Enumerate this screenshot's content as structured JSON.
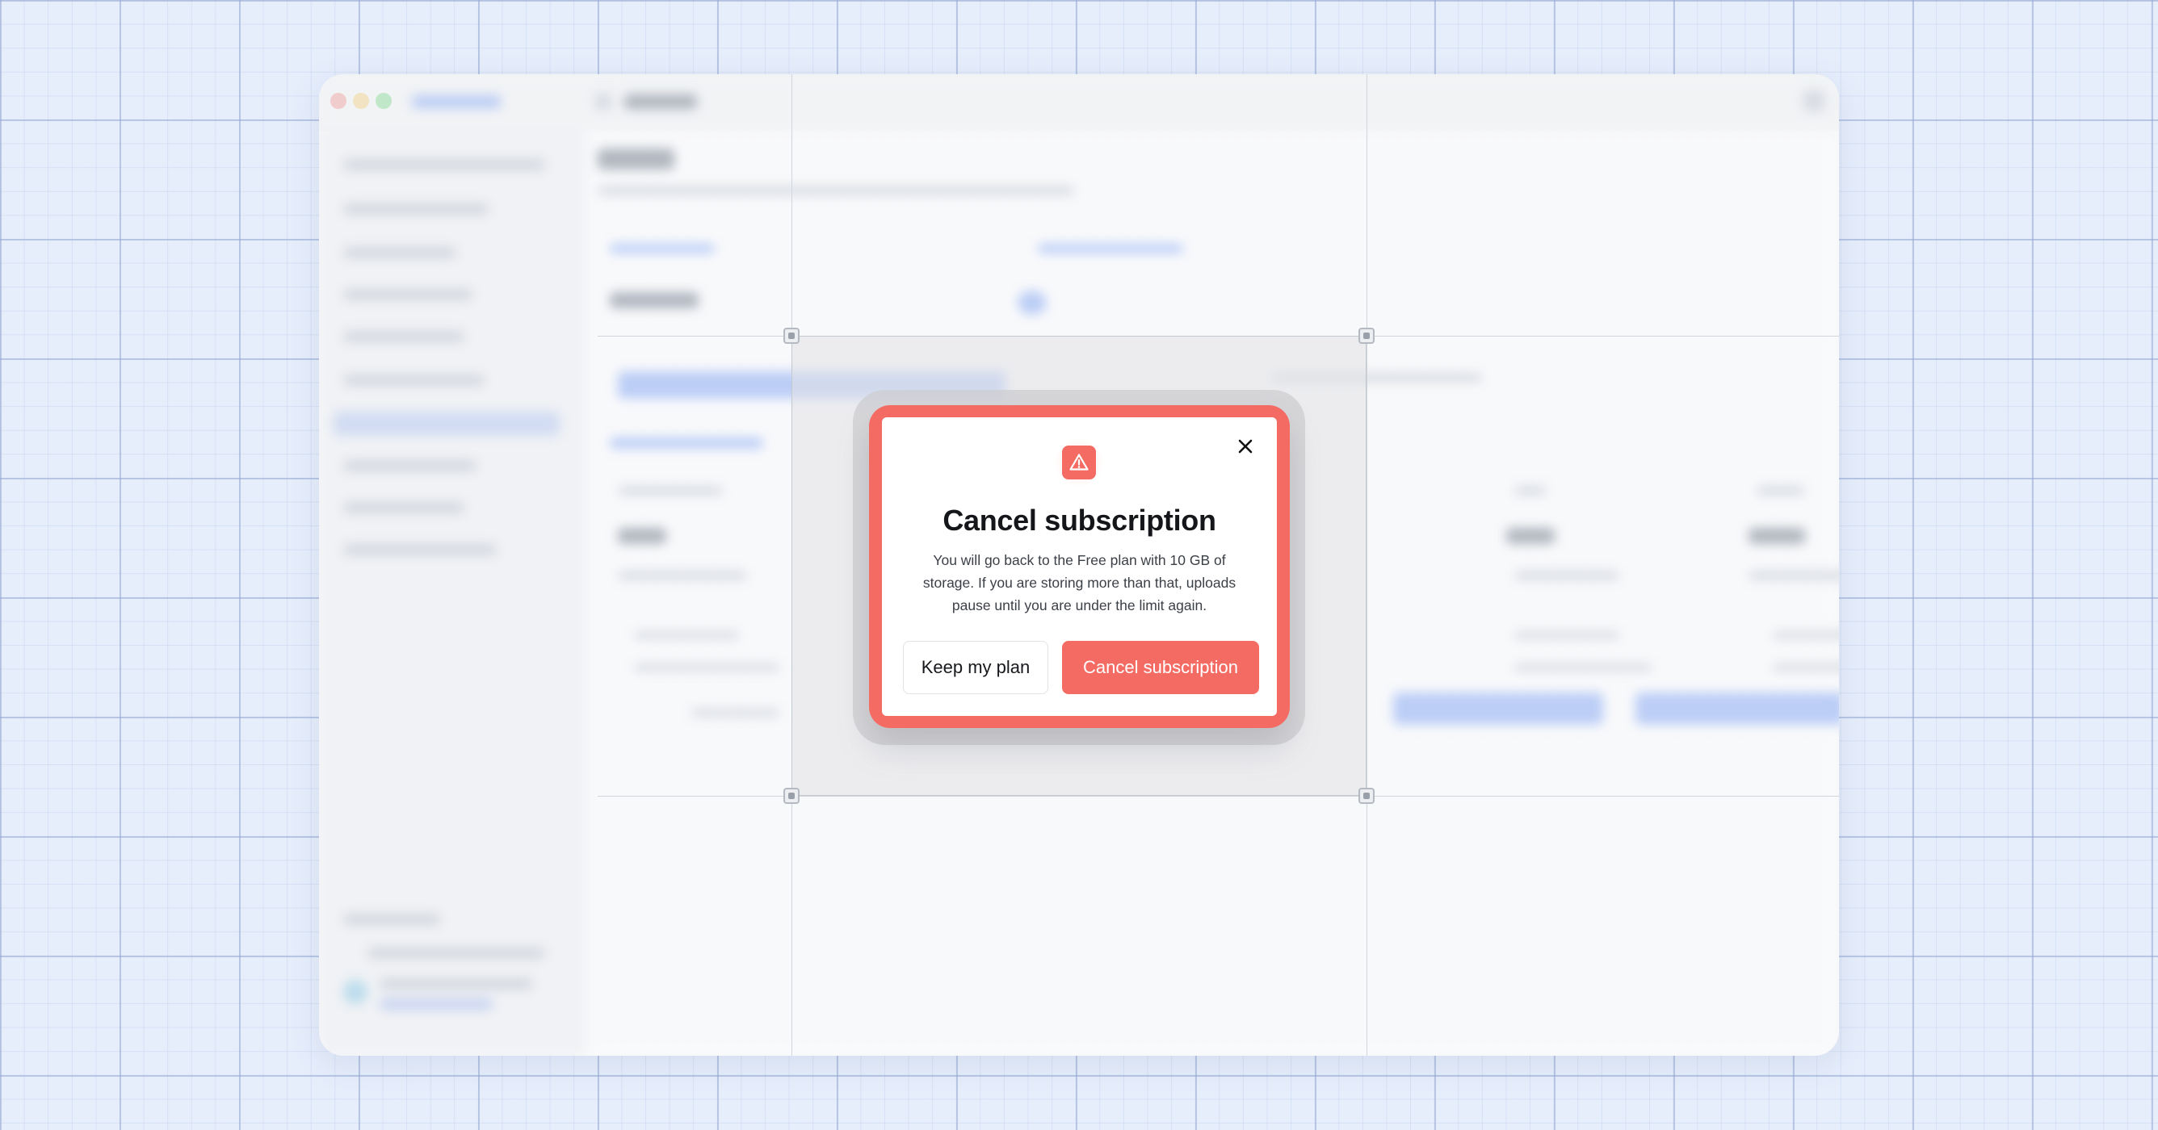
{
  "dialog": {
    "title": "Cancel subscription",
    "message": "You will go back to the Free plan with 10 GB of storage. If you are storing more than that, uploads pause until you are under the limit again.",
    "secondary_button": "Keep my plan",
    "primary_button": "Cancel subscription",
    "icon": "warning-triangle-icon",
    "close_icon": "close-icon"
  },
  "colors": {
    "accent_danger": "#f46b64",
    "background": "#e6eefc",
    "traffic_red": "#f25a57",
    "traffic_yellow": "#f5b92f",
    "traffic_green": "#2ec446"
  }
}
